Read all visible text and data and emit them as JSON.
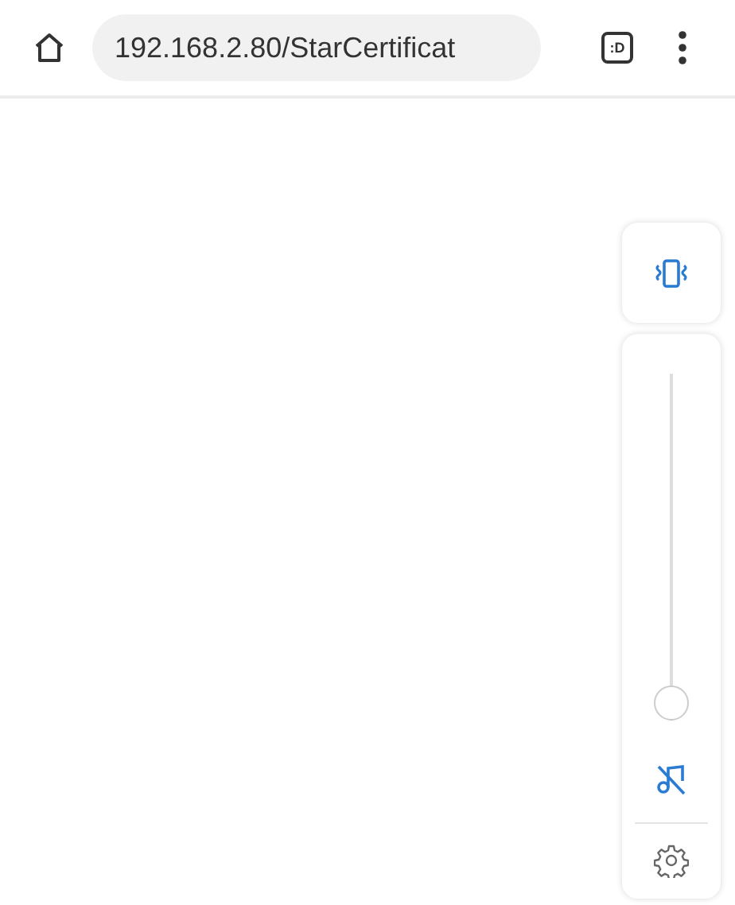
{
  "address_bar": {
    "url": "192.168.2.80/StarCertificat"
  },
  "tab_switcher": {
    "label": ":D"
  },
  "volume_panel": {
    "vibrate": true,
    "media_muted": true,
    "volume": {
      "level": 0
    }
  }
}
